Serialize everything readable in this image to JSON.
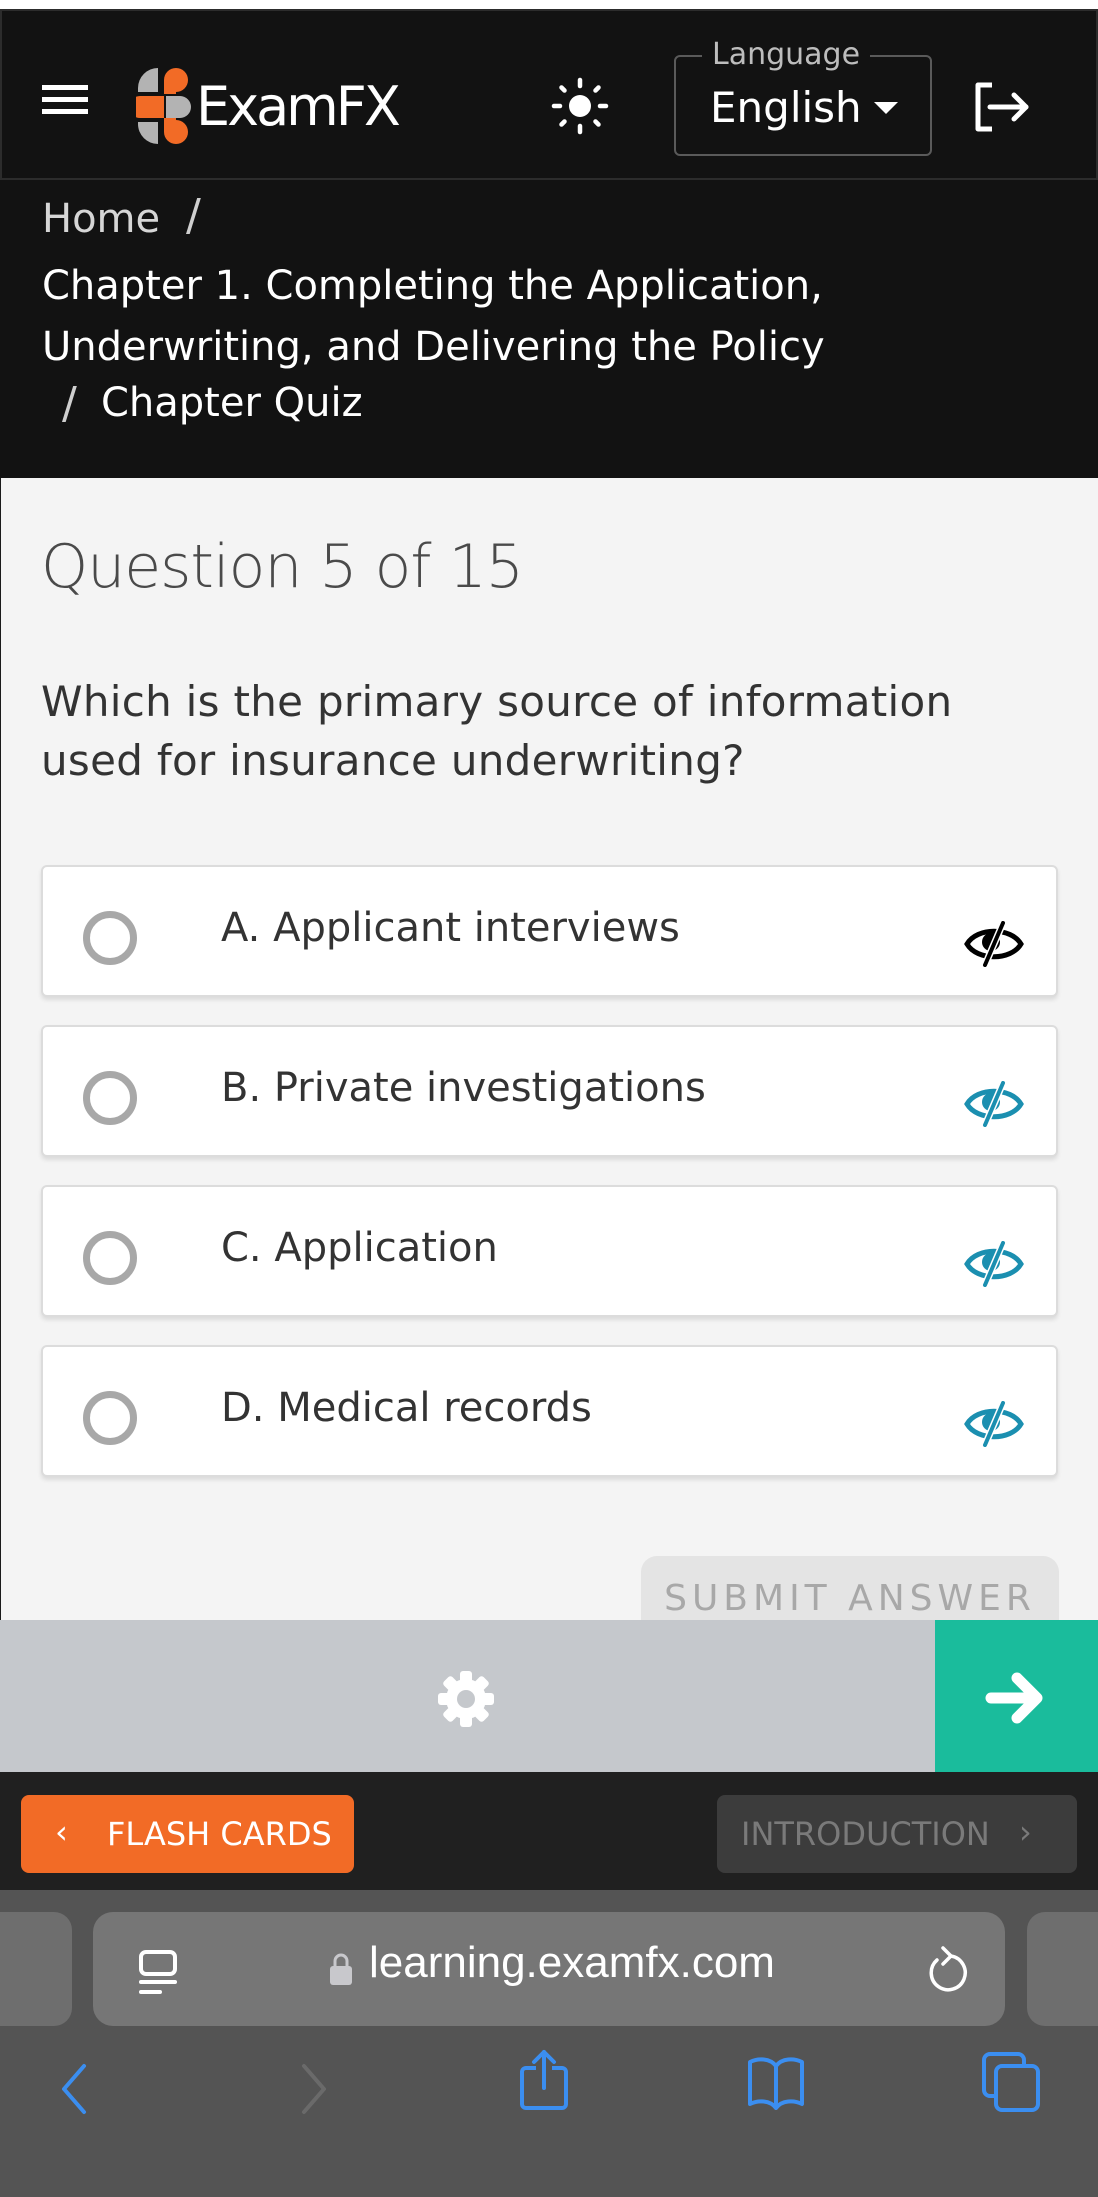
{
  "header": {
    "brand": "ExamFX",
    "language_label": "Language",
    "language_value": "English"
  },
  "breadcrumb": {
    "home": "Home",
    "separator": "/",
    "chapter": "Chapter 1. Completing the Application, Underwriting, and Delivering the Policy",
    "current": "Chapter Quiz"
  },
  "question": {
    "title": "Question 5 of 15",
    "number": 5,
    "total": 15,
    "text": "Which is the primary source of information used for insurance underwriting?",
    "options": [
      {
        "label": "A. Applicant interviews",
        "eye_icon": "eye-slash-icon",
        "eye_color": "#000000",
        "selected": false
      },
      {
        "label": "B. Private investigations",
        "eye_icon": "eye-slash-icon",
        "eye_color": "#1b8fb0",
        "selected": false
      },
      {
        "label": "C. Application",
        "eye_icon": "eye-slash-icon",
        "eye_color": "#1b8fb0",
        "selected": false
      },
      {
        "label": "D. Medical records",
        "eye_icon": "eye-slash-icon",
        "eye_color": "#1b8fb0",
        "selected": false
      }
    ],
    "submit_label": "SUBMIT ANSWER"
  },
  "action_bar": {
    "settings_icon": "gear-icon",
    "next_icon": "arrow-right-icon",
    "accent_color": "#1abc9c"
  },
  "nav": {
    "prev_label": "FLASH CARDS",
    "prev_color": "#f26b26",
    "next_label": "INTRODUCTION"
  },
  "browser": {
    "url": "learning.examfx.com",
    "toolbar_icons": [
      "back-icon",
      "forward-icon",
      "share-icon",
      "bookmarks-icon",
      "tabs-icon"
    ],
    "tint_color": "#3b8ef0"
  }
}
